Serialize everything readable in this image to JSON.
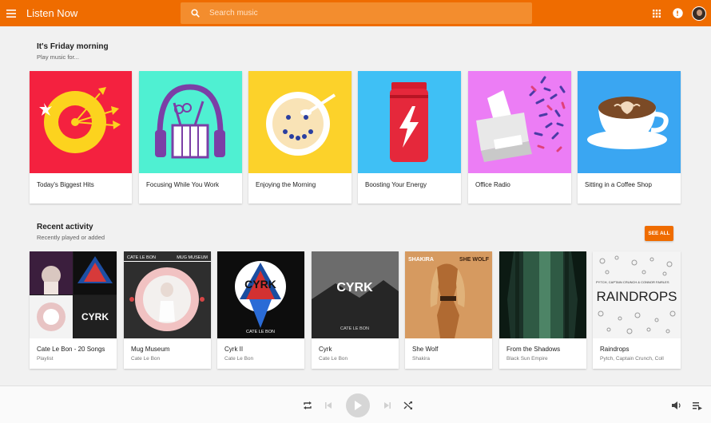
{
  "header": {
    "title": "Listen Now",
    "search_placeholder": "Search music"
  },
  "friday": {
    "title": "It's Friday morning",
    "subtitle": "Play music for...",
    "cards": [
      {
        "label": "Today's Biggest Hits",
        "bg": "#f4213f"
      },
      {
        "label": "Focusing While You Work",
        "bg": "#4ff0d2"
      },
      {
        "label": "Enjoying the Morning",
        "bg": "#fcd22a"
      },
      {
        "label": "Boosting Your Energy",
        "bg": "#3fc0f5"
      },
      {
        "label": "Office Radio",
        "bg": "#ec7df5"
      },
      {
        "label": "Sitting in a Coffee Shop",
        "bg": "#3aa6f2"
      }
    ]
  },
  "recent": {
    "title": "Recent activity",
    "subtitle": "Recently played or added",
    "see_all": "SEE ALL",
    "cards": [
      {
        "title": "Cate Le Bon - 20 Songs",
        "sub": "Playlist"
      },
      {
        "title": "Mug Museum",
        "sub": "Cate Le Bon",
        "art_top_left": "CATE LE BON",
        "art_top_right": "MUG MUSEUM"
      },
      {
        "title": "Cyrk II",
        "sub": "Cate Le Bon",
        "art_text": "CYRK",
        "art_bottom": "CATE LE BON"
      },
      {
        "title": "Cyrk",
        "sub": "Cate Le Bon",
        "art_text": "CYRK",
        "art_bottom": "CATE LE BON"
      },
      {
        "title": "She Wolf",
        "sub": "Shakira",
        "art_left": "SHAKIRA",
        "art_right": "SHE WOLF"
      },
      {
        "title": "From the Shadows",
        "sub": "Black Sun Empire"
      },
      {
        "title": "Raindrops",
        "sub": "Pytch, Captain Crunch, Coll",
        "art_small": "PYTCH, CAPTAIN CRUNCH & CONNOR FAIRLES",
        "art_text": "RAINDROPS"
      }
    ]
  },
  "colors": {
    "accent": "#ef6c00",
    "search_bg": "#f38d2e"
  },
  "icons": [
    "menu-icon",
    "search-icon",
    "apps-grid-icon",
    "notifications-icon",
    "repeat-icon",
    "previous-icon",
    "play-icon",
    "next-icon",
    "shuffle-icon",
    "volume-icon",
    "queue-icon"
  ]
}
